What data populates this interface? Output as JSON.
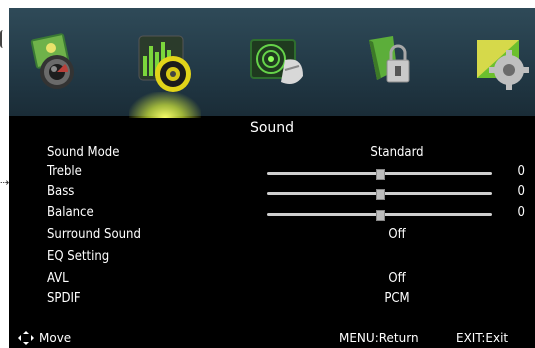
{
  "menu_title": "Sound",
  "tabs": [
    {
      "id": "picture",
      "icon": "picture-icon"
    },
    {
      "id": "sound",
      "icon": "sound-icon",
      "selected": true
    },
    {
      "id": "channel",
      "icon": "channel-icon"
    },
    {
      "id": "lock",
      "icon": "lock-icon"
    },
    {
      "id": "setup",
      "icon": "setup-icon"
    }
  ],
  "settings": {
    "sound_mode": {
      "label": "Sound Mode",
      "value": "Standard"
    },
    "treble": {
      "label": "Treble",
      "value": "0",
      "level": 0.5
    },
    "bass": {
      "label": "Bass",
      "value": "0",
      "level": 0.5
    },
    "balance": {
      "label": "Balance",
      "value": "0",
      "level": 0.5
    },
    "surround": {
      "label": "Surround Sound",
      "value": "Off"
    },
    "eq": {
      "label": "EQ Setting"
    },
    "avl": {
      "label": "AVL",
      "value": "Off"
    },
    "spdif": {
      "label": "SPDIF",
      "value": "PCM"
    }
  },
  "footer": {
    "move": "Move",
    "menu_return": "MENU:Return",
    "exit": "EXIT:Exit"
  },
  "colors": {
    "bar_top": "#2f4a58",
    "selected_glow": "#f8ff6a",
    "text": "#ffffff"
  }
}
